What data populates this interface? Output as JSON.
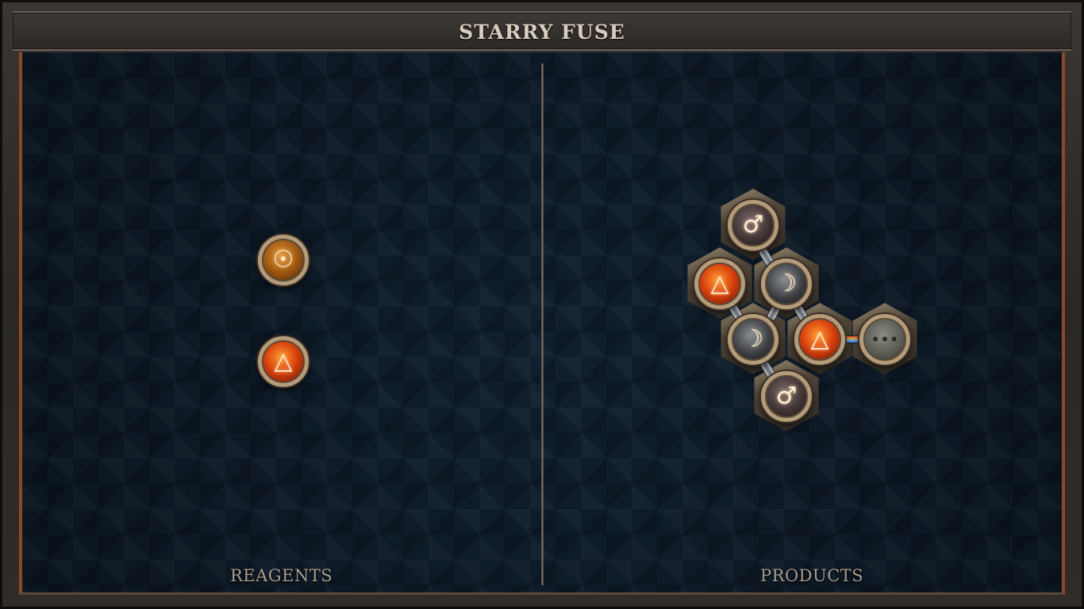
{
  "title": "STARRY FUSE",
  "sections": {
    "reagents_label": "REAGENTS",
    "products_label": "PRODUCTS"
  },
  "reagents": [
    {
      "element": "salt",
      "symbol": "☉",
      "icon": "gold-orb-icon"
    },
    {
      "element": "fire",
      "symbol": "△",
      "icon": "fire-orb-icon"
    }
  ],
  "product_atoms": [
    {
      "id": "a1",
      "element": "iron",
      "symbol": "♂"
    },
    {
      "id": "a2",
      "element": "fire",
      "symbol": "△"
    },
    {
      "id": "a3",
      "element": "silver",
      "symbol": "☽"
    },
    {
      "id": "a4",
      "element": "silver",
      "symbol": "☽"
    },
    {
      "id": "a5",
      "element": "fire",
      "symbol": "△"
    },
    {
      "id": "a6",
      "element": "quintessence",
      "symbol": "•••"
    },
    {
      "id": "a7",
      "element": "iron",
      "symbol": "♂"
    }
  ],
  "colors": {
    "board_bg": "#101f2e",
    "frame_accent": "#8a4a26",
    "title_text": "#d8cdbd",
    "label_text": "#a89c8e"
  }
}
